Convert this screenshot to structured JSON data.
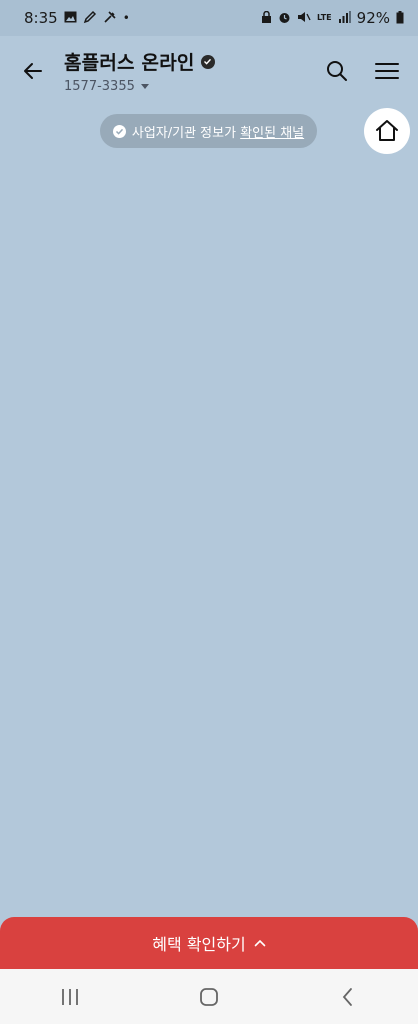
{
  "status_bar": {
    "time": "8:35",
    "battery": "92%",
    "left_icons": [
      "gallery-icon",
      "pencil-icon",
      "tools-icon",
      "dot-icon"
    ],
    "right_icons": [
      "lock-icon",
      "alarm-icon",
      "mute-icon",
      "lte-icon",
      "signal-icon",
      "battery-icon"
    ],
    "lte_label": "LTE"
  },
  "header": {
    "title": "홈플러스 온라인",
    "phone": "1577-3355"
  },
  "verified_pill": {
    "text_prefix": "사업자/기관 정보가 ",
    "link_text": "확인된 채널"
  },
  "cta": {
    "label": "혜택 확인하기"
  },
  "colors": {
    "background": "#b3c8da",
    "cta": "#d9413f",
    "pill": "#98aab9"
  }
}
